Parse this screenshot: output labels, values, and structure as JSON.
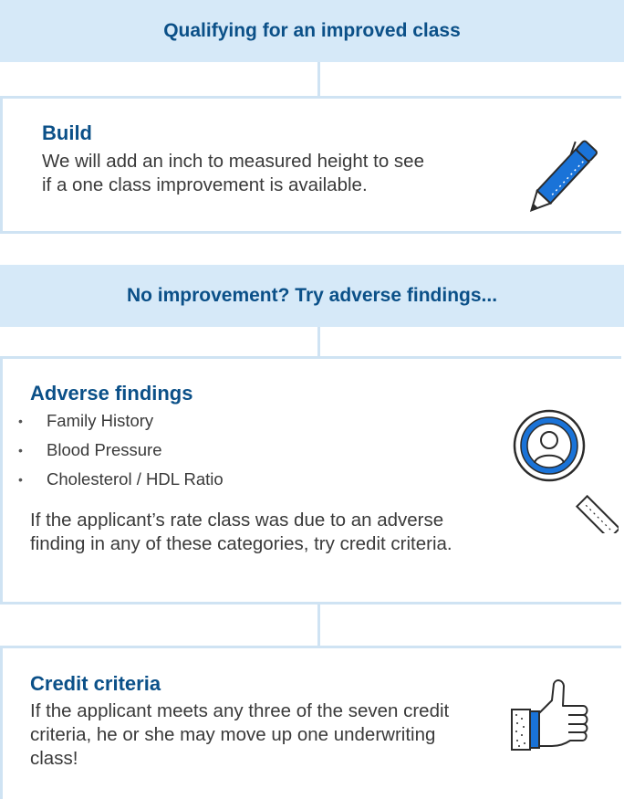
{
  "sections": {
    "banner1": "Qualifying for an improved class",
    "build": {
      "title": "Build",
      "text": "We will add an inch to measured height to see if a one class improvement is available."
    },
    "banner2": "No improvement? Try adverse findings...",
    "adverse": {
      "title": "Adverse findings",
      "bullets": [
        "Family History",
        "Blood Pressure",
        "Cholesterol / HDL Ratio"
      ],
      "text": "If the applicant’s rate class was due to an adverse finding in any of these categories, try credit criteria."
    },
    "credit": {
      "title": "Credit criteria",
      "text": "If the applicant meets any three of the seven credit criteria, he or she may move up one underwriting class!"
    }
  },
  "icons": {
    "build": "pen-icon",
    "adverse": "magnifier-person-icon",
    "credit": "thumbs-up-icon"
  },
  "colors": {
    "banner_bg": "#d6e9f8",
    "title": "#0b5088",
    "accent": "#1a73d8",
    "border": "#cfe3f3",
    "text": "#3a3a3a"
  }
}
